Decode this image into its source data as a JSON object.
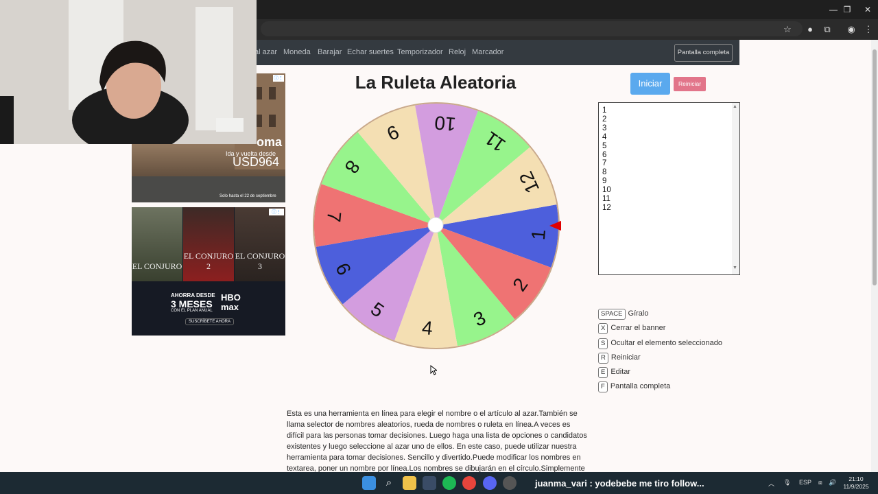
{
  "site": {
    "nav": [
      "al azar",
      "Moneda",
      "Barajar",
      "Echar suertes",
      "Temporizador",
      "Reloj",
      "Marcador"
    ],
    "fullscreen_label": "Pantalla completa"
  },
  "page": {
    "title": "La Ruleta Aleatoria",
    "start_label": "Iniciar",
    "reset_label": "Reiniciar"
  },
  "wheel": {
    "segments": [
      "1",
      "2",
      "3",
      "4",
      "5",
      "6",
      "7",
      "8",
      "9",
      "10",
      "11",
      "12"
    ],
    "colors": [
      "#4d5fdc",
      "#ef7373",
      "#97f48c",
      "#f4dfb3",
      "#d39ddf",
      "#4d5fdc",
      "#ef7373",
      "#97f48c",
      "#f4dfb3",
      "#d39ddf",
      "#97f48c",
      "#f4dfb3"
    ],
    "rotation_deg": 35,
    "pointer_color": "#e00000"
  },
  "editor": {
    "names_text": "1\n2\n3\n4\n5\n6\n7\n8\n9\n10\n11\n12"
  },
  "shortcuts": [
    {
      "key": "SPACE",
      "label": "Gíralo"
    },
    {
      "key": "X",
      "label": "Cerrar el banner"
    },
    {
      "key": "S",
      "label": "Ocultar el elemento seleccionado"
    },
    {
      "key": "R",
      "label": "Reiniciar"
    },
    {
      "key": "E",
      "label": "Editar"
    },
    {
      "key": "F",
      "label": "Pantalla completa"
    }
  ],
  "description": "Esta es una herramienta en línea para elegir el nombre o el artículo al azar.También se llama selector de nombres aleatorios, rueda de nombres o ruleta en línea.A veces es difícil para las personas tomar decisiones. Luego haga una lista de opciones o candidatos existentes y luego seleccione al azar uno de ellos. En este caso, puede utilizar nuestra herramienta para tomar decisiones. Sencillo y divertido.Puede modificar los nombres en textarea, poner un nombre por línea.Los nombres se dibujarán en el círculo.Simplemente haga clic en la rueda",
  "ads": {
    "ad1": {
      "city": "oma",
      "line": "Ida y vuelta desde",
      "price": "USD964",
      "note": "Solo hasta el 22 de septiembre"
    },
    "ad2": {
      "posters": [
        {
          "title": "EL CONJURO"
        },
        {
          "title": "EL CONJURO 2"
        },
        {
          "title": "EL CONJURO 3"
        }
      ],
      "offer_1": "AHORRA DESDE",
      "offer_2": "3 MESES",
      "offer_3": "CON EL PLAN ANUAL",
      "brand_1": "HBO",
      "brand_2": "max",
      "cta": "SUSCRÍBETE AHORA"
    }
  },
  "taskbar": {
    "chat_text": "juanma_vari : yodebebe me tiro follow...",
    "lang": "ESP",
    "time": "21:10",
    "date": "11/9/2025"
  }
}
